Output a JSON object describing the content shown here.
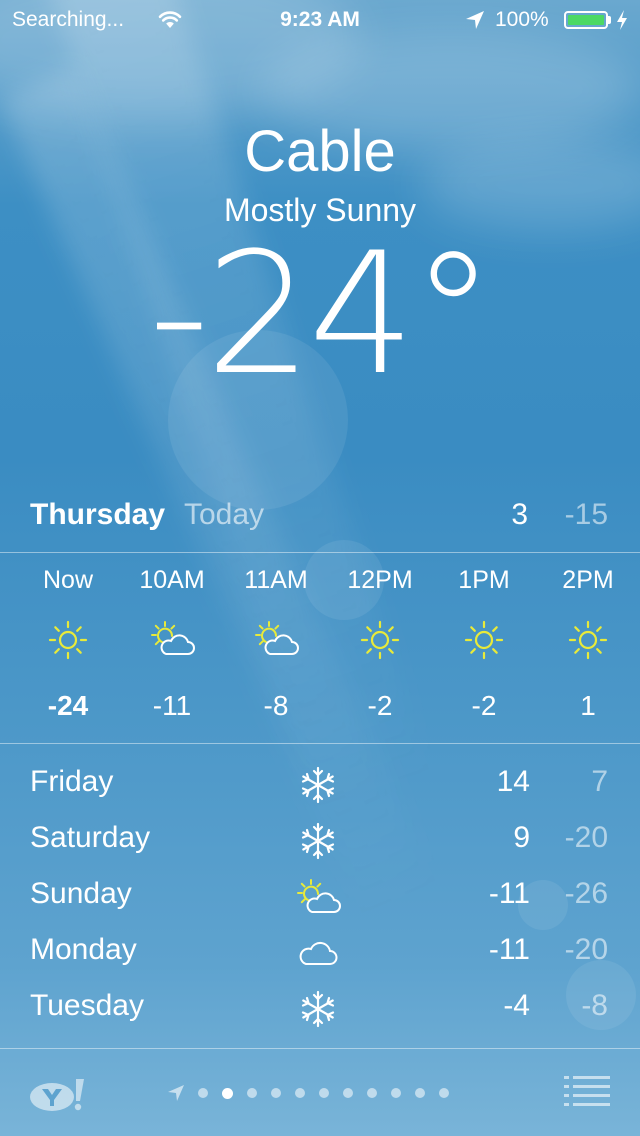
{
  "status_bar": {
    "carrier": "Searching...",
    "time": "9:23 AM",
    "battery_percent": "100%",
    "battery_color": "#4cd964"
  },
  "location": {
    "city": "Cable",
    "condition": "Mostly Sunny",
    "temperature": "-24°"
  },
  "today": {
    "day": "Thursday",
    "label": "Today",
    "high": "3",
    "low": "-15"
  },
  "hourly": [
    {
      "time": "Now",
      "icon": "sun-icon",
      "temp": "-24"
    },
    {
      "time": "10AM",
      "icon": "partly-cloudy-icon",
      "temp": "-11"
    },
    {
      "time": "11AM",
      "icon": "partly-cloudy-icon",
      "temp": "-8"
    },
    {
      "time": "12PM",
      "icon": "sun-icon",
      "temp": "-2"
    },
    {
      "time": "1PM",
      "icon": "sun-icon",
      "temp": "-2"
    },
    {
      "time": "2PM",
      "icon": "sun-icon",
      "temp": "1"
    }
  ],
  "daily": [
    {
      "day": "Friday",
      "icon": "snowflake-icon",
      "high": "14",
      "low": "7"
    },
    {
      "day": "Saturday",
      "icon": "snowflake-icon",
      "high": "9",
      "low": "-20"
    },
    {
      "day": "Sunday",
      "icon": "partly-cloudy-icon",
      "high": "-11",
      "low": "-26"
    },
    {
      "day": "Monday",
      "icon": "cloud-icon",
      "high": "-11",
      "low": "-20"
    },
    {
      "day": "Tuesday",
      "icon": "snowflake-icon",
      "high": "-4",
      "low": "-8"
    }
  ],
  "footer": {
    "page_count": 11,
    "active_page": 1
  }
}
